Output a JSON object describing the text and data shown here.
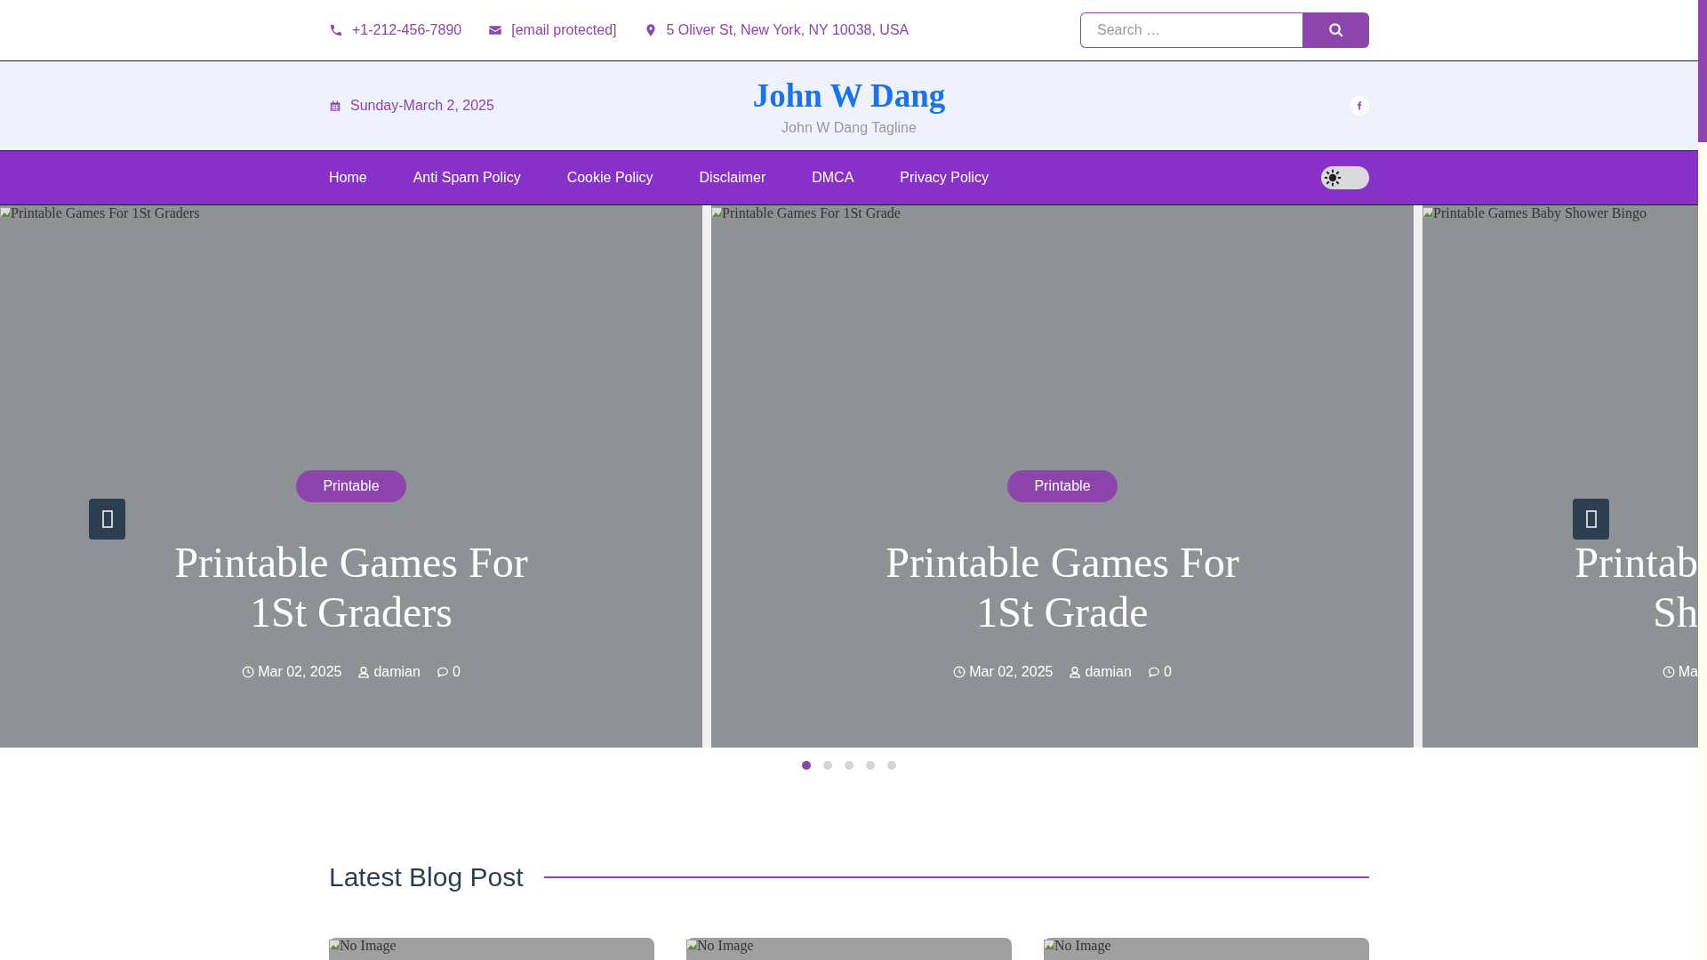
{
  "top_bar": {
    "phone": "+1-212-456-7890",
    "email": "[email protected]",
    "address": "5 Oliver St, New York, NY 10038, USA",
    "search": {
      "placeholder": "Search …"
    }
  },
  "header": {
    "date": "Sunday-March 2, 2025",
    "site_title": "John W Dang",
    "tagline": "John W Dang Tagline"
  },
  "nav": {
    "items": [
      "Home",
      "Anti Spam Policy",
      "Cookie Policy",
      "Disclaimer",
      "DMCA",
      "Privacy Policy"
    ],
    "dark_mode": false
  },
  "slides": [
    {
      "kind": "full",
      "image_alt": "Printable Games For 1St Graders",
      "category": "Printable",
      "title_lines": [
        "Printable Games For",
        "1St Graders"
      ],
      "date": "Mar 02, 2025",
      "author": "damian",
      "comments": "0"
    },
    {
      "kind": "full",
      "image_alt": "Printable Games For 1St Grade",
      "category": "Printable",
      "title_lines": [
        "Printable Games For",
        "1St Grade"
      ],
      "date": "Mar 02, 2025",
      "author": "damian",
      "comments": "0"
    },
    {
      "kind": "cut",
      "image_alt": "Printable Games Baby Shower Bingo",
      "title_lines": [
        "Printab",
        "Sh"
      ],
      "date": "Ma"
    }
  ],
  "slider_dots": [
    {
      "selected": true
    },
    {
      "selected": false
    },
    {
      "selected": false
    },
    {
      "selected": false
    },
    {
      "selected": false
    }
  ],
  "latest": {
    "heading": "Latest Blog Post",
    "cards": [
      {
        "image_alt": "No Image"
      },
      {
        "image_alt": "No Image"
      },
      {
        "image_alt": "No Image"
      }
    ]
  }
}
